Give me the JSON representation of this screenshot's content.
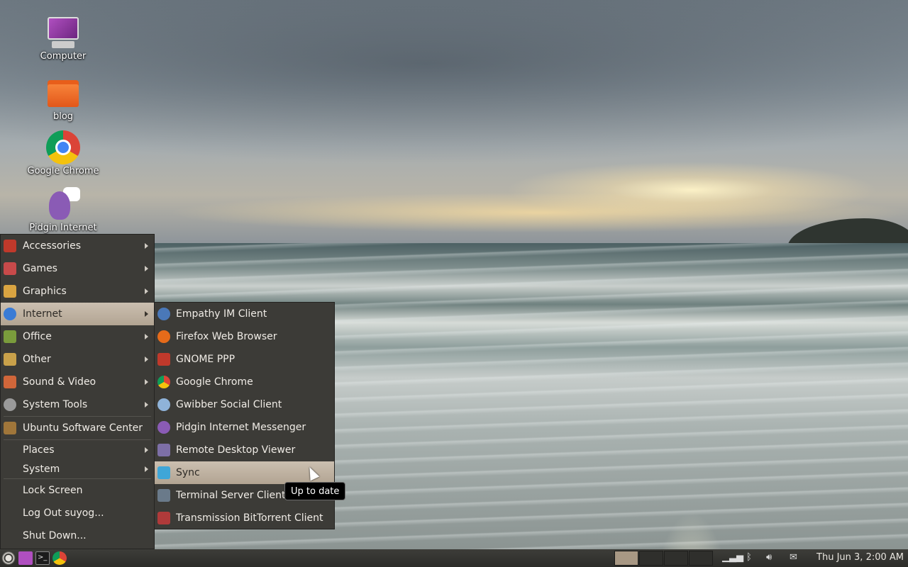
{
  "desktop": {
    "icons": [
      {
        "label": "Computer",
        "icon": "computer-icon"
      },
      {
        "label": "blog",
        "icon": "folder-icon"
      },
      {
        "label": "Google Chrome",
        "icon": "chrome-icon"
      },
      {
        "label": "Pidgin Internet",
        "icon": "pidgin-icon"
      }
    ]
  },
  "main_menu": {
    "items": [
      {
        "label": "Accessories",
        "icon": "accessories-icon",
        "color": "#c0392b"
      },
      {
        "label": "Games",
        "icon": "games-icon",
        "color": "#c84a4a"
      },
      {
        "label": "Graphics",
        "icon": "graphics-icon",
        "color": "#d9a441"
      },
      {
        "label": "Internet",
        "icon": "internet-icon",
        "color": "#3a7bd5"
      },
      {
        "label": "Office",
        "icon": "office-icon",
        "color": "#7a9c3c"
      },
      {
        "label": "Other",
        "icon": "other-icon",
        "color": "#c9a14a"
      },
      {
        "label": "Sound & Video",
        "icon": "sound-video-icon",
        "color": "#d0663a"
      },
      {
        "label": "System Tools",
        "icon": "system-tools-icon",
        "color": "#9a9a9a"
      },
      {
        "label": "Ubuntu Software Center",
        "icon": "software-center-icon",
        "color": "#a0763a"
      },
      {
        "label": "Places"
      },
      {
        "label": "System"
      },
      {
        "label": "Lock Screen"
      },
      {
        "label": "Log Out suyog..."
      },
      {
        "label": "Shut Down..."
      }
    ]
  },
  "sub_menu": {
    "items": [
      {
        "label": "Empathy IM Client",
        "icon": "empathy-icon",
        "color": "#4a78b8"
      },
      {
        "label": "Firefox Web Browser",
        "icon": "firefox-icon",
        "color": "#e66b1a"
      },
      {
        "label": "GNOME PPP",
        "icon": "gnome-ppp-icon",
        "color": "#c0392b"
      },
      {
        "label": "Google Chrome",
        "icon": "chrome-icon",
        "color": "#3cba54"
      },
      {
        "label": "Gwibber Social Client",
        "icon": "gwibber-icon",
        "color": "#8fb3d9"
      },
      {
        "label": "Pidgin Internet Messenger",
        "icon": "pidgin-icon",
        "color": "#8a5bb5"
      },
      {
        "label": "Remote Desktop Viewer",
        "icon": "remote-desktop-icon",
        "color": "#7d6fa6"
      },
      {
        "label": "Sync",
        "icon": "sync-icon",
        "color": "#3fa6d8"
      },
      {
        "label": "Terminal Server Client",
        "icon": "terminal-server-icon",
        "color": "#6a7a8a"
      },
      {
        "label": "Transmission BitTorrent Client",
        "icon": "transmission-icon",
        "color": "#b03a3a"
      }
    ]
  },
  "tooltip": {
    "text": "Up to date"
  },
  "panel": {
    "clock": "Thu Jun  3,  2:00 AM"
  },
  "colors": {
    "menu_bg": "#3c3b37",
    "highlight": "#b2a492",
    "panel": "#3d3d39"
  }
}
